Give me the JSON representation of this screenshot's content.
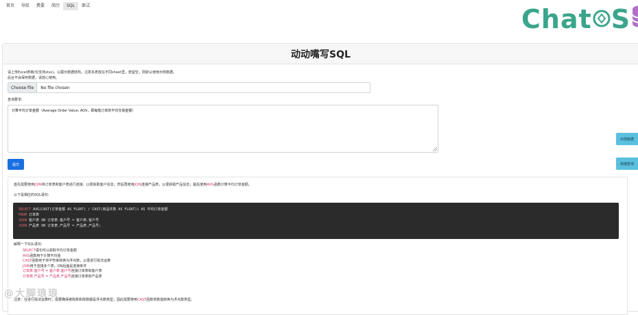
{
  "nav": {
    "items": [
      {
        "label": "首页",
        "active": false
      },
      {
        "label": "导航",
        "active": false
      },
      {
        "label": "费要",
        "active": false
      },
      {
        "label": "简历",
        "active": false
      },
      {
        "label": "SQL",
        "active": true
      },
      {
        "label": "面试",
        "active": false
      }
    ]
  },
  "logo": {
    "text_left": "Chat",
    "text_right": "S",
    "color": "#3aa58b"
  },
  "header": {
    "title": "动动嘴写SQL"
  },
  "upload": {
    "notice_line1": "请上传Excel表格(仅支持xlsx)，以展示数据结构，注意多表放在不同sheet里，若留空，则默认使用示例数据。",
    "notice_line2": "后台不会保存数据，请放心使用。",
    "choose_label": "Choose file",
    "file_name": "No file chosen"
  },
  "query": {
    "label": "查询要求:",
    "value": "计算平均订单金额（Average Order Value, AOV，即每笔订单的平均交易金额）"
  },
  "buttons": {
    "submit": "提交",
    "example": "示例数据",
    "quick": "快捷查询"
  },
  "answer": {
    "intro_a": "首先需要使用",
    "intro_join1": "JOIN",
    "intro_b": "将订单表和客户表进行连接，以便获取客户信息；然后再使用",
    "intro_join2": "JOIN",
    "intro_c": "连接产品表，以便获取产品信息；最后使用",
    "intro_avg": "AVG",
    "intro_d": "函数计算平均订单金额。",
    "sql_intro": "以下是相应的SQL语句:",
    "code": [
      {
        "kw": "SELECT",
        "rest": " AVG(CAST(订单金额 AS FLOAT) / CAST(商品件数 AS FLOAT)) AS 平均订单金额"
      },
      {
        "kw": "FROM",
        "rest": " 订单表"
      },
      {
        "kw": "JOIN",
        "rest": " 客户表 ON 订单表.客户号 = 客户表.客户号"
      },
      {
        "kw": "JOIN",
        "rest": " 产品表 ON 订单表.产品号 = 产品表.产品号;"
      }
    ],
    "explain_title": "解释一下SQL语句:",
    "explain": [
      {
        "kw": "SELECT",
        "rest": "语句可以获取平均订单金额"
      },
      {
        "kw": "AVG",
        "rest": "函数用于计算平均值"
      },
      {
        "kw": "CAST",
        "rest": "函数用于将字符串转换为浮点数，以便进行除法运算"
      },
      {
        "kw": "JOIN",
        "rest": "用于连接多个表，ON后面是连接条件"
      },
      {
        "kw": "订单表.客户号 = 客户表.客户号",
        "rest": "连接订单表和客户表"
      },
      {
        "kw": "订单表.产品号 = 产品表.产品号",
        "rest": "连接订单表和产品表"
      }
    ],
    "note_a": "注意：在进行除法运算时，需要确保被除数和除数都是浮点数类型，因此需要使用",
    "note_cast": "CAST",
    "note_b": "函数将数值转换为浮点数类型。"
  },
  "watermark": "@大脚琅琅"
}
